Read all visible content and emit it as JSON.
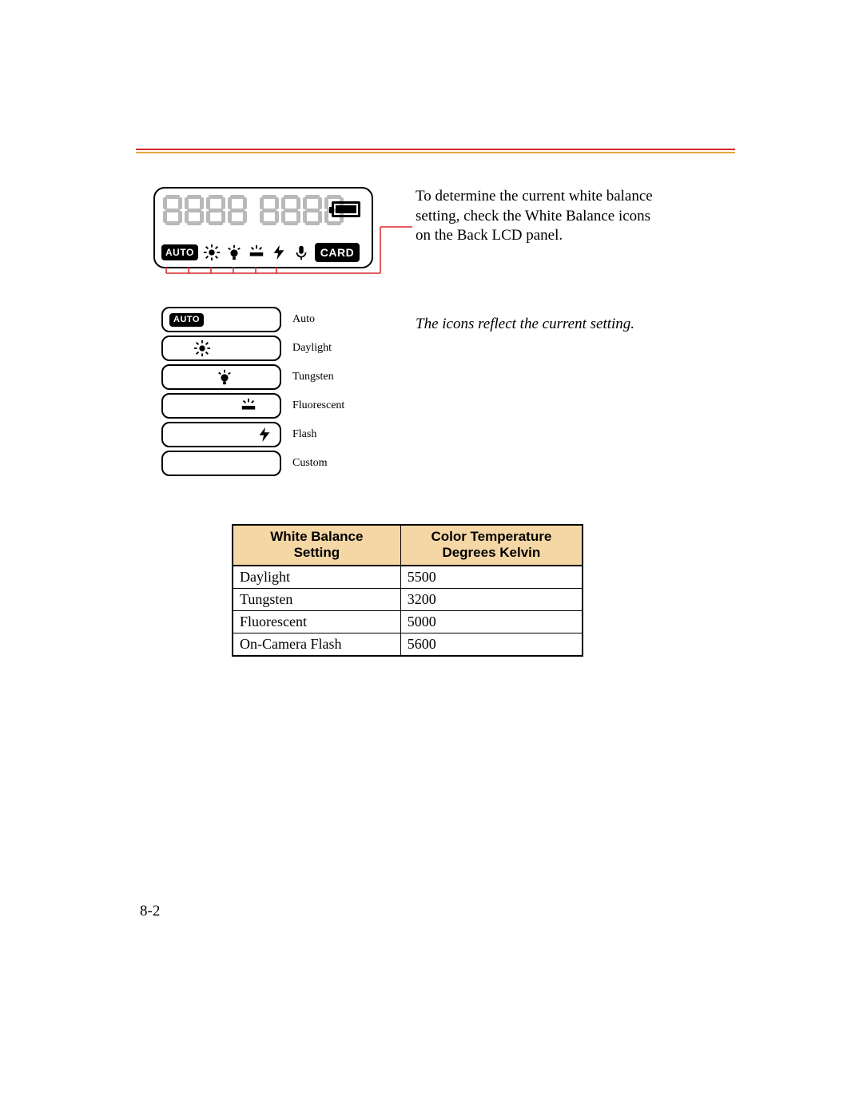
{
  "rules": {
    "red": "#d8262a",
    "gold": "#e0a93e"
  },
  "lcd": {
    "digit_placeholder": "8888 8888",
    "icons": {
      "auto": "AUTO",
      "card": "CARD"
    }
  },
  "paragraph": "To determine the current white balance setting, check the White Balance icons on the Back LCD panel.",
  "caption": "The icons reflect the current setting.",
  "legend": [
    {
      "id": "auto",
      "label": "Auto"
    },
    {
      "id": "daylight",
      "label": "Daylight"
    },
    {
      "id": "tungsten",
      "label": "Tungsten"
    },
    {
      "id": "fluorescent",
      "label": "Fluorescent"
    },
    {
      "id": "flash",
      "label": "Flash"
    },
    {
      "id": "custom",
      "label": "Custom"
    }
  ],
  "table": {
    "headers": {
      "col1_line1": "White Balance",
      "col1_line2": "Setting",
      "col2_line1": "Color Temperature",
      "col2_line2": "Degrees Kelvin"
    },
    "rows": [
      {
        "setting": "Daylight",
        "kelvin": "5500"
      },
      {
        "setting": "Tungsten",
        "kelvin": "3200"
      },
      {
        "setting": "Fluorescent",
        "kelvin": "5000"
      },
      {
        "setting": "On-Camera Flash",
        "kelvin": "5600"
      }
    ]
  },
  "page_number": "8-2",
  "chart_data": {
    "type": "table",
    "title": "White Balance Setting vs Color Temperature (Degrees Kelvin)",
    "columns": [
      "White Balance Setting",
      "Color Temperature Degrees Kelvin"
    ],
    "rows": [
      [
        "Daylight",
        5500
      ],
      [
        "Tungsten",
        3200
      ],
      [
        "Fluorescent",
        5000
      ],
      [
        "On-Camera Flash",
        5600
      ]
    ]
  }
}
